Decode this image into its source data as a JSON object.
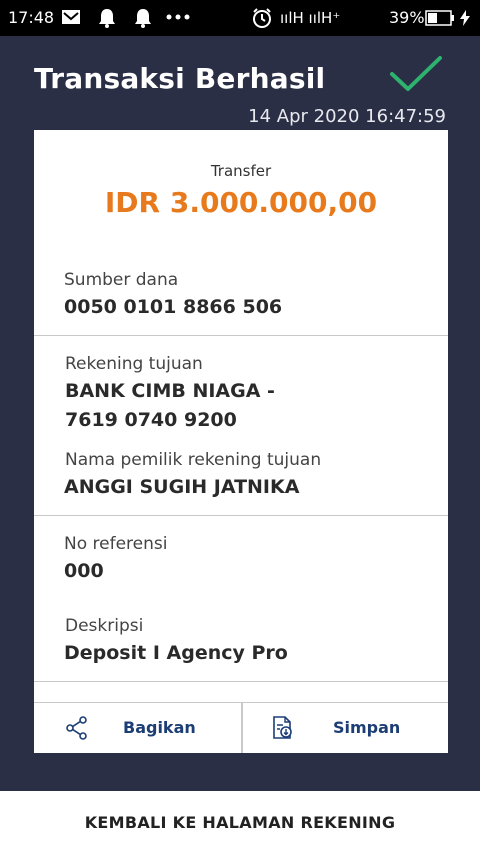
{
  "status_bar": {
    "time": "17:48",
    "signal_text": "ıılH  ıılH⁺",
    "battery": "39%",
    "icons": [
      "mail-icon",
      "bell-icon",
      "bell-icon",
      "more-dots-icon",
      "alarm-icon",
      "signal-icon",
      "battery-icon",
      "charging-icon"
    ]
  },
  "header": {
    "title": "Transaksi Berhasil",
    "datetime": "14 Apr 2020 16:47:59",
    "success_icon": "checkmark-icon",
    "accent_color": "#2db36f"
  },
  "receipt": {
    "type_label": "Transfer",
    "amount": "IDR 3.000.000,00",
    "amount_color": "#e77a1d",
    "source_label": "Sumber dana",
    "source_value": "0050 0101 8866 506",
    "dest_label": "Rekening tujuan",
    "dest_bank": "BANK CIMB NIAGA -",
    "dest_account": "7619 0740 9200",
    "owner_label": "Nama pemilik rekening tujuan",
    "owner_value": "ANGGI SUGIH JATNIKA",
    "ref_label": "No referensi",
    "ref_value": "000",
    "desc_label": "Deskripsi",
    "desc_value": "Deposit I Agency Pro"
  },
  "actions": {
    "share_label": "Bagikan",
    "save_label": "Simpan"
  },
  "footer": {
    "back_label": "KEMBALI KE HALAMAN REKENING"
  }
}
